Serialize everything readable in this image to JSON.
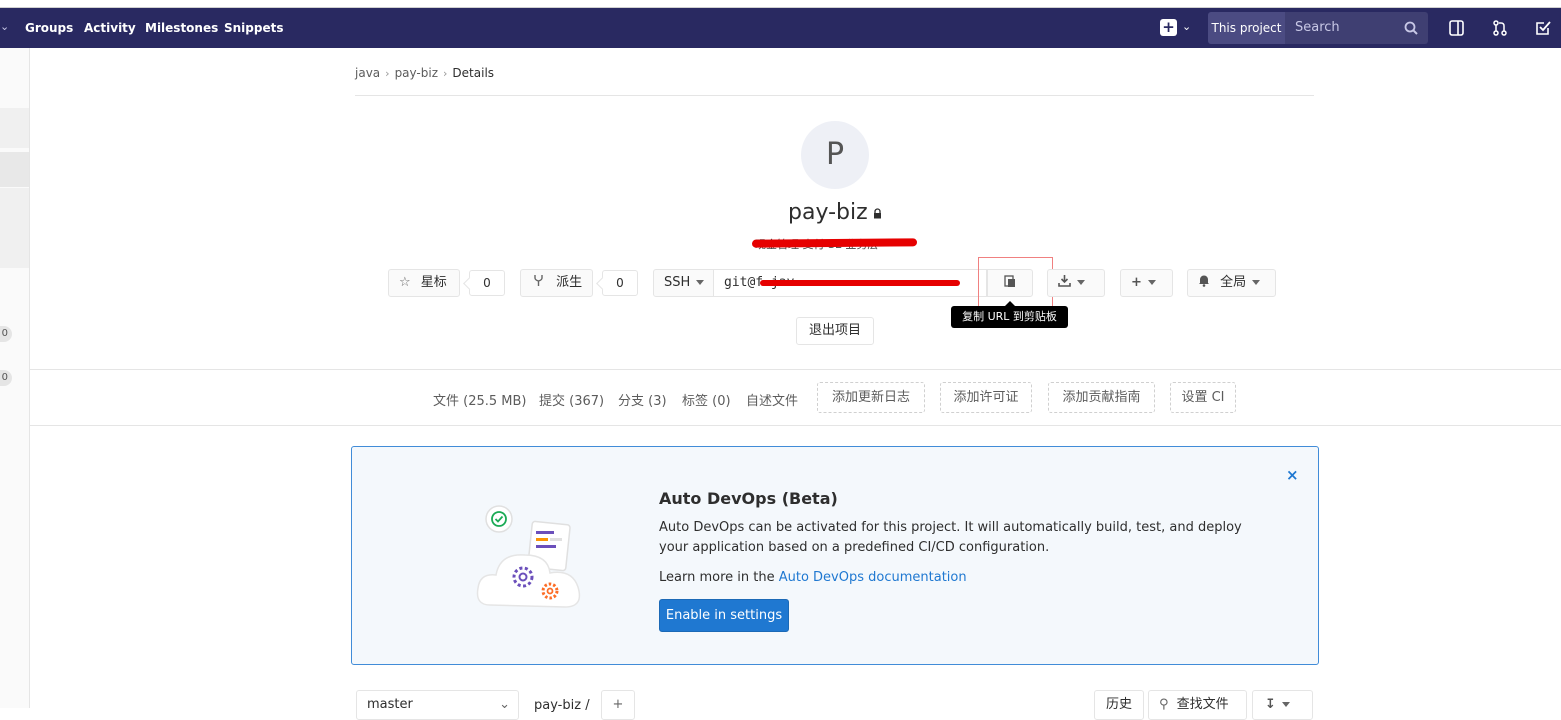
{
  "navbar": {
    "links": [
      "Groups",
      "Activity",
      "Milestones",
      "Snippets"
    ],
    "scope_label": "This project",
    "search_placeholder": "Search"
  },
  "sidebar": {
    "badges": [
      "0",
      "0"
    ]
  },
  "breadcrumb": {
    "items": [
      "java",
      "pay-biz",
      "Details"
    ]
  },
  "project": {
    "avatar_letter": "P",
    "name": "pay-biz",
    "description": "现金管理 支付 SE 业务层"
  },
  "actions": {
    "star_label": "星标",
    "star_count": "0",
    "fork_label": "派生",
    "fork_count": "0",
    "protocol": "SSH",
    "clone_url": "git@f                          jav",
    "copy_tooltip": "复制 URL 到剪贴板",
    "notification_label": "全局",
    "leave_label": "退出项目"
  },
  "stats": {
    "files": "文件 (25.5 MB)",
    "commits": "提交 (367)",
    "branches": "分支 (3)",
    "tags": "标签 (0)",
    "readme": "自述文件",
    "add_changelog": "添加更新日志",
    "add_license": "添加许可证",
    "add_contributing": "添加贡献指南",
    "setup_ci": "设置 CI"
  },
  "devops": {
    "title": "Auto DevOps (Beta)",
    "line1": "Auto DevOps can be activated for this project. It will automatically build, test, and deploy",
    "line2": "your application based on a predefined CI/CD configuration.",
    "learn_prefix": "Learn more in the ",
    "learn_link": "Auto DevOps documentation",
    "button": "Enable in settings",
    "close": "×"
  },
  "bottom": {
    "branch": "master",
    "path": "pay-biz /",
    "history": "历史",
    "find_file": "查找文件"
  },
  "colors": {
    "navbar": "#292961",
    "primary": "#1f78d1",
    "redaction": "#e60000"
  }
}
